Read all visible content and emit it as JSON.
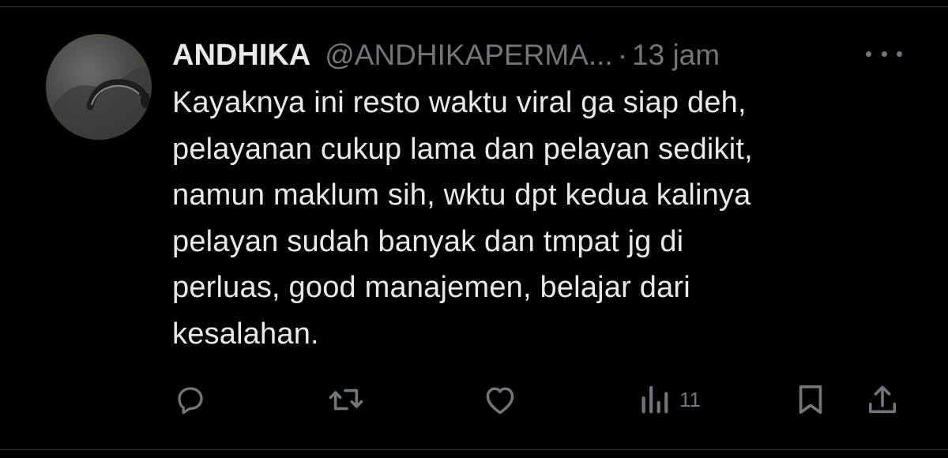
{
  "tweet": {
    "display_name": "ANDHIKA",
    "handle": "@ANDHIKAPERMA...",
    "separator": "·",
    "time": "13 jam",
    "text": "Kayaknya ini resto waktu viral ga siap deh,\npelayanan cukup lama dan pelayan sedikit,\nnamun maklum sih, wktu dpt kedua kalinya\npelayan sudah banyak dan tmpat jg di\nperluas, good manajemen, belajar dari\nkesalahan.",
    "views_count": "11"
  },
  "icons": {
    "more": "more-icon",
    "reply": "reply-icon",
    "retweet": "retweet-icon",
    "like": "like-icon",
    "views": "views-icon",
    "bookmark": "bookmark-icon",
    "share": "share-icon"
  },
  "colors": {
    "background": "#000000",
    "primary_text": "#e7e9ea",
    "secondary_text": "#71767b",
    "divider": "#2f3336"
  }
}
